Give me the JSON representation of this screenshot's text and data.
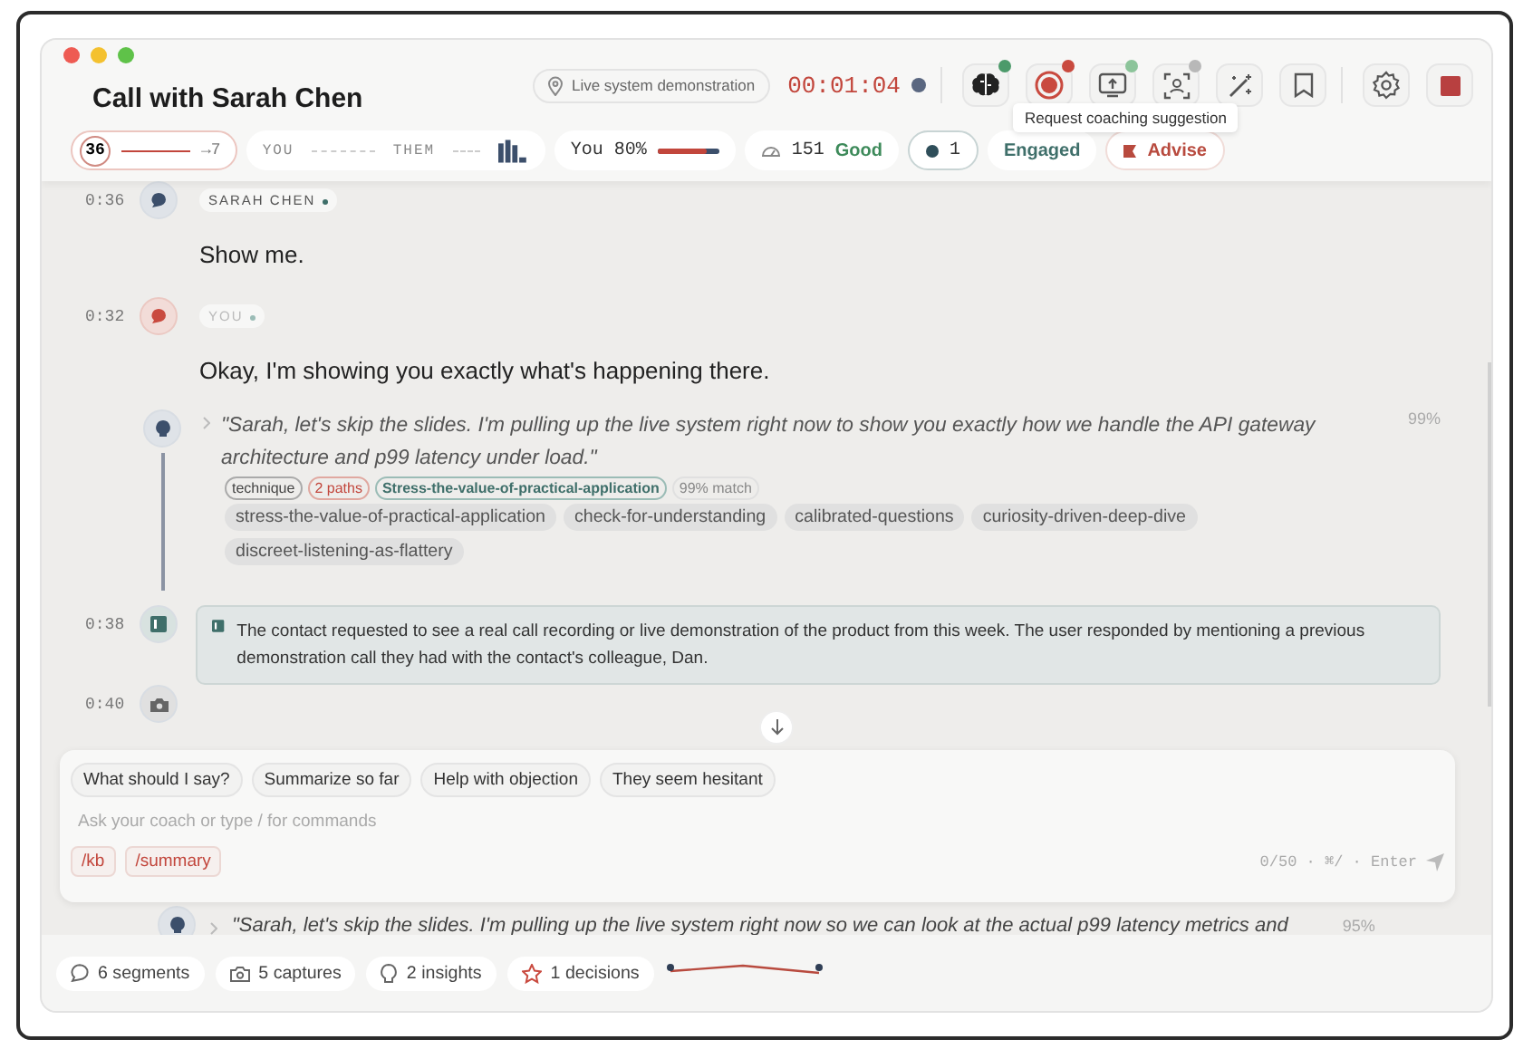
{
  "window": {
    "title": "Call with Sarah Chen"
  },
  "header": {
    "scenario": "Live system demonstration",
    "timer": "00:01:04",
    "recording": true,
    "tools": [
      {
        "kind": "brain",
        "color": "#4c9a6a"
      },
      {
        "kind": "record",
        "color": "#c94a3f"
      },
      {
        "kind": "screen",
        "color": "#8cc49a"
      },
      {
        "kind": "face",
        "color": "#b8b8b8"
      },
      {
        "kind": "wand"
      },
      {
        "kind": "bookmark"
      },
      {
        "kind": "settings"
      },
      {
        "kind": "stop"
      }
    ],
    "tooltip": "Request coaching suggestion"
  },
  "metrics": [
    {
      "kind": "score",
      "value": "36",
      "target": "→7"
    },
    {
      "kind": "talk",
      "you": "YOU",
      "them": "THEM"
    },
    {
      "kind": "ratio",
      "label": "You 80%",
      "level": 0.8
    },
    {
      "kind": "pace",
      "value": "151",
      "status": "Good"
    },
    {
      "kind": "count",
      "value": "1"
    },
    {
      "kind": "tag",
      "label": "Engaged"
    },
    {
      "kind": "flag",
      "label": "Advise"
    }
  ],
  "transcript": [
    {
      "kind": "speech",
      "time": "0:36",
      "speaker": "SARAH CHEN",
      "is_user": false,
      "text": "Show me."
    },
    {
      "kind": "speech",
      "time": "0:32",
      "speaker": "YOU",
      "is_user": true,
      "text": "Okay, I'm showing you exactly what's happening there."
    },
    {
      "kind": "insight",
      "quote": "\"Sarah, let's skip the slides. I'm pulling up the live system right now to show you exactly how we handle the API gateway architecture and p99 latency under load.\"",
      "score": "99%",
      "tags": [
        {
          "kind": "plain",
          "label": "technique"
        },
        {
          "kind": "warn",
          "label": "2 paths"
        },
        {
          "kind": "good",
          "label": "Stress-the-value-of-practical-application"
        },
        {
          "kind": "muted",
          "label": "99% match"
        }
      ],
      "chips": [
        "stress-the-value-of-practical-application",
        "check-for-understanding",
        "calibrated-questions",
        "curiosity-driven-deep-dive",
        "discreet-listening-as-flattery"
      ]
    },
    {
      "kind": "summary",
      "time": "0:38",
      "text": "The contact requested to see a real call recording or live demonstration of the product from this week. The user responded by mentioning a previous demonstration call they had with the contact's colleague, Dan."
    },
    {
      "kind": "capture",
      "time": "0:40"
    }
  ],
  "composer": {
    "suggestions": [
      "What should I say?",
      "Summarize so far",
      "Help with objection",
      "They seem hesitant"
    ],
    "placeholder": "Ask your coach or type / for commands",
    "commands": [
      "/kb",
      "/summary"
    ],
    "counter": "0/50 · ⌘/ · Enter"
  },
  "peek": {
    "quote": "\"Sarah, let's skip the slides. I'm pulling up the live system right now so we can look at the actual p99 latency metrics and",
    "score": "95%"
  },
  "footer": [
    {
      "kind": "segments",
      "label": "6 segments"
    },
    {
      "kind": "captures",
      "label": "5 captures"
    },
    {
      "kind": "insights",
      "label": "2 insights"
    },
    {
      "kind": "decisions",
      "label": "1 decisions"
    }
  ]
}
